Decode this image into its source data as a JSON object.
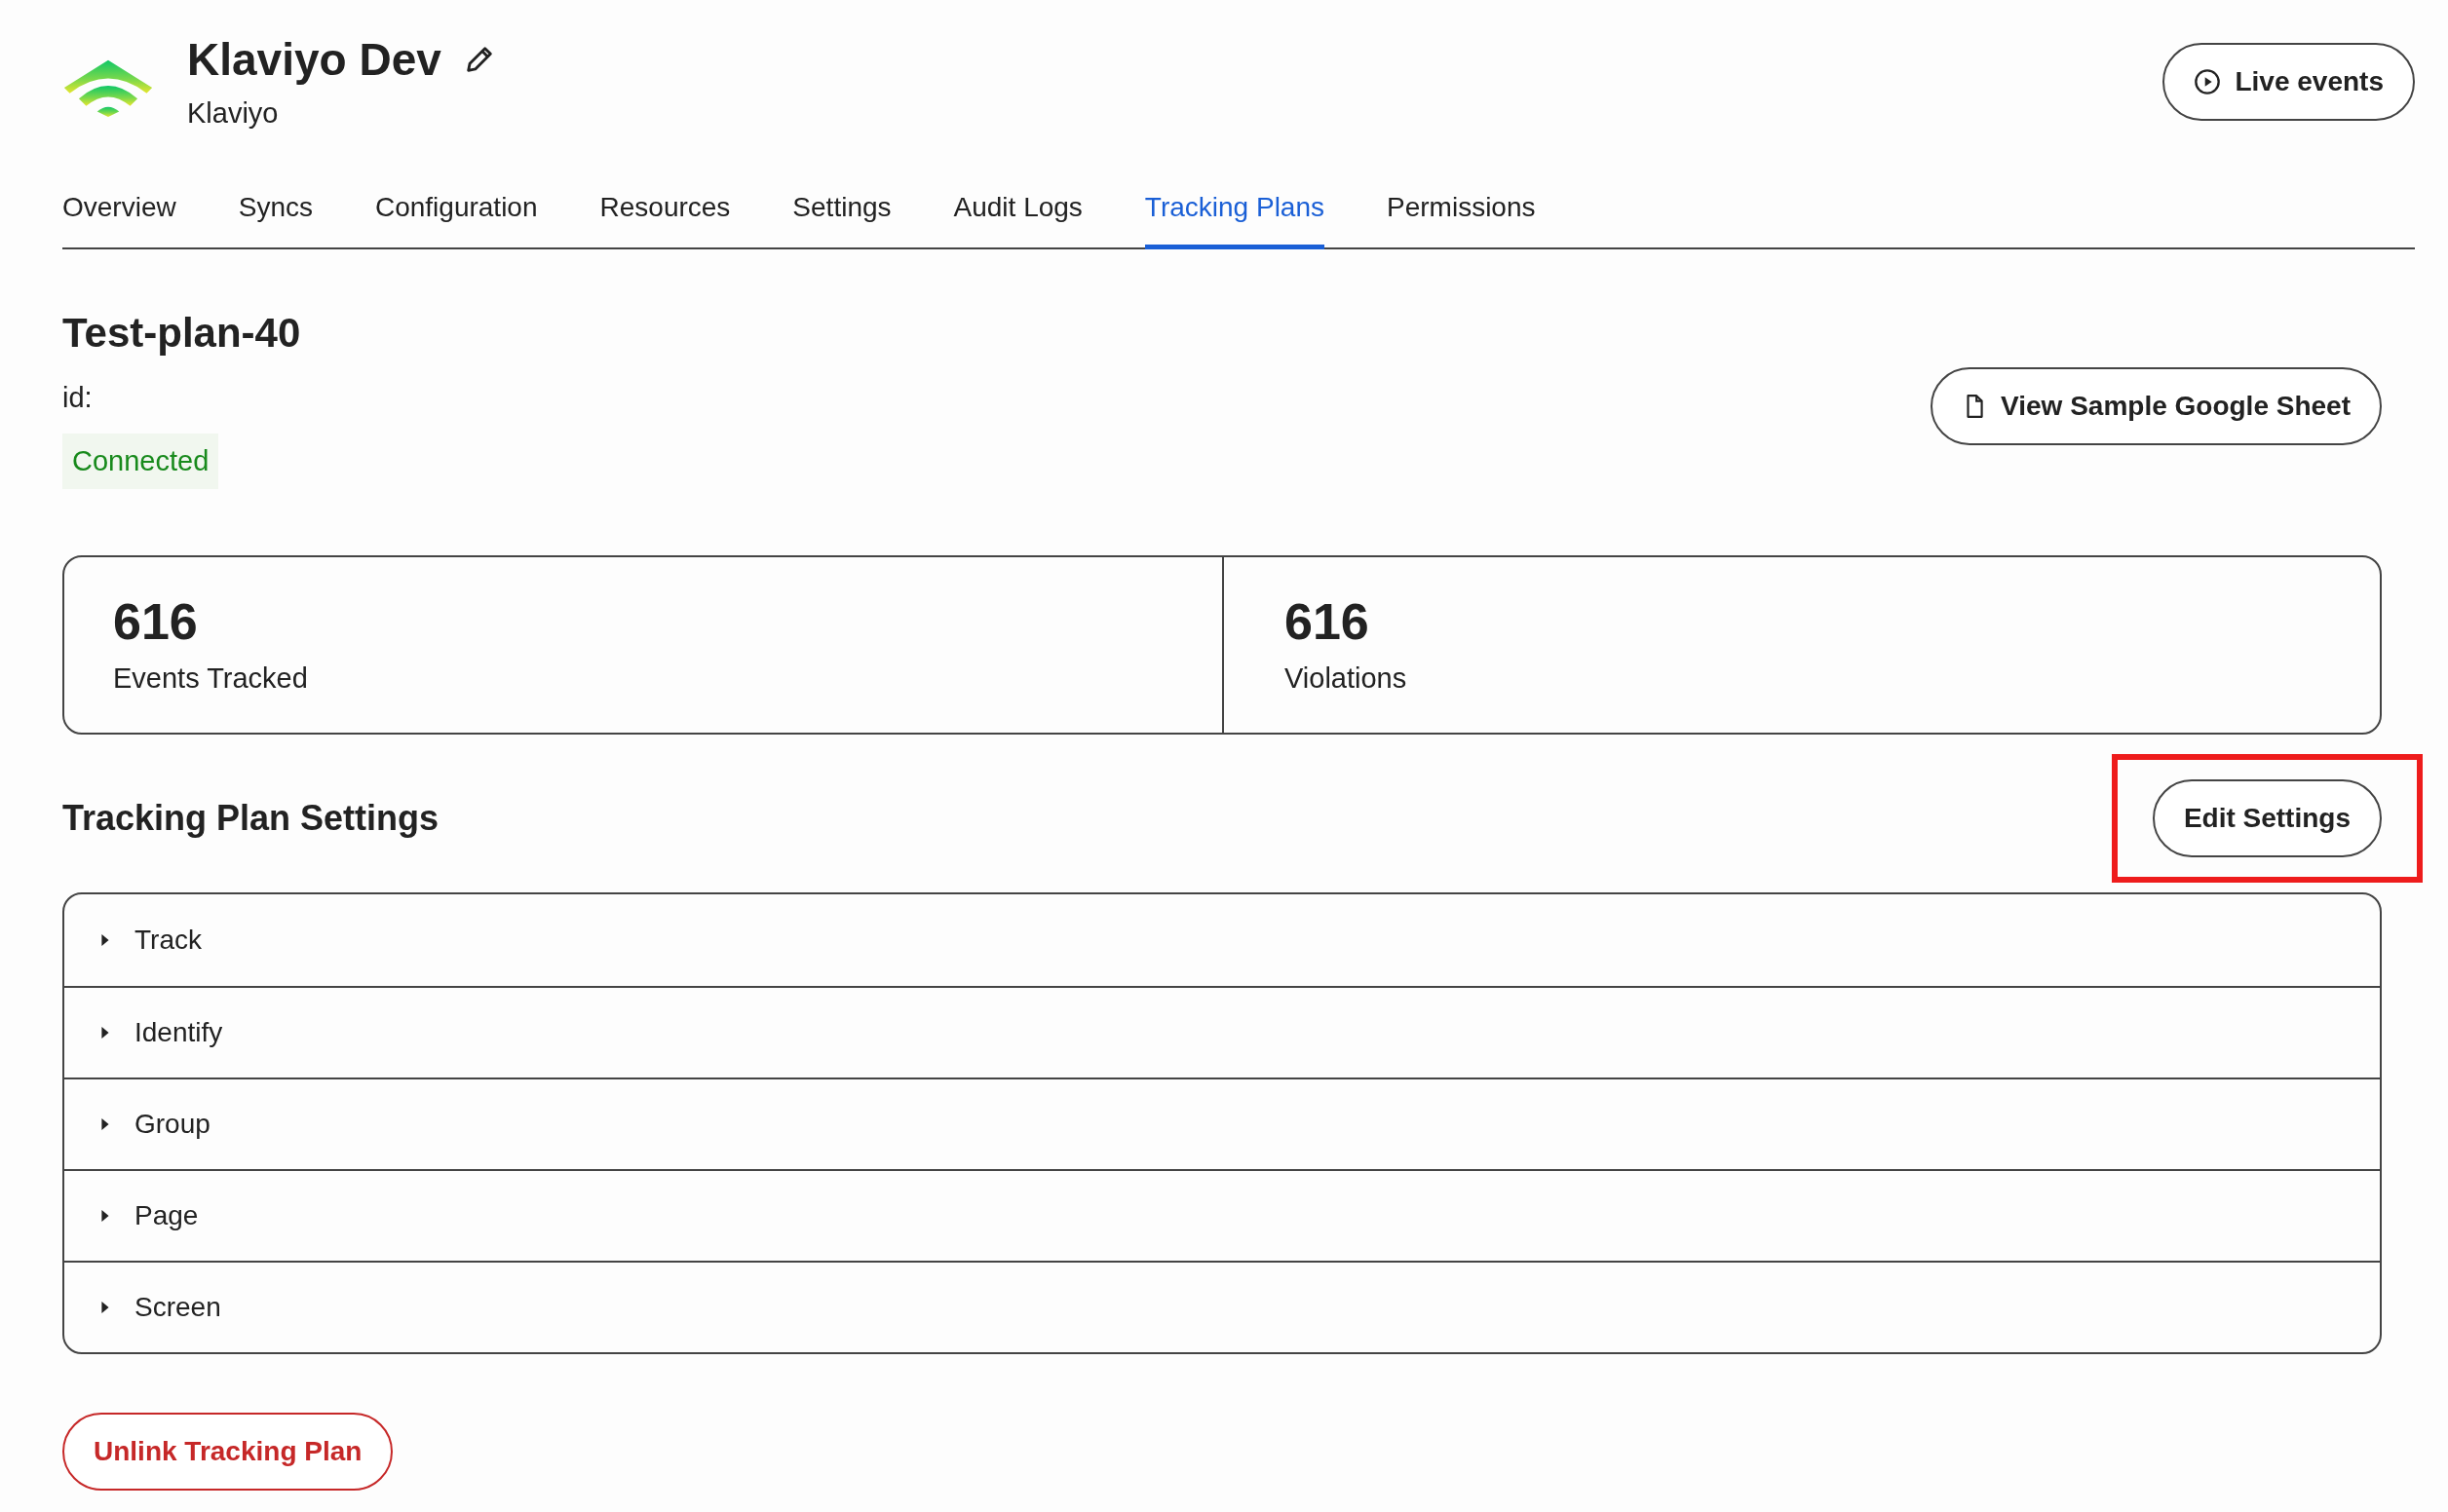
{
  "header": {
    "title": "Klaviyo Dev",
    "subtitle": "Klaviyo",
    "live_button": "Live events"
  },
  "tabs": [
    {
      "label": "Overview",
      "selected": false
    },
    {
      "label": "Syncs",
      "selected": false
    },
    {
      "label": "Configuration",
      "selected": false
    },
    {
      "label": "Resources",
      "selected": false
    },
    {
      "label": "Settings",
      "selected": false
    },
    {
      "label": "Audit Logs",
      "selected": false
    },
    {
      "label": "Tracking Plans",
      "selected": true
    },
    {
      "label": "Permissions",
      "selected": false
    }
  ],
  "plan": {
    "name": "Test-plan-40",
    "id_label": "id:",
    "status": "Connected",
    "connected": true,
    "sheet_button": "View Sample Google Sheet"
  },
  "stats": [
    {
      "value": "616",
      "label": "Events Tracked"
    },
    {
      "value": "616",
      "label": "Violations"
    }
  ],
  "settings": {
    "title": "Tracking Plan Settings",
    "edit_button": "Edit Settings",
    "edit_highlighted": true,
    "sections": [
      {
        "label": "Track",
        "expanded": false
      },
      {
        "label": "Identify",
        "expanded": false
      },
      {
        "label": "Group",
        "expanded": false
      },
      {
        "label": "Page",
        "expanded": false
      },
      {
        "label": "Screen",
        "expanded": false
      }
    ]
  },
  "unlink_button": "Unlink Tracking Plan"
}
